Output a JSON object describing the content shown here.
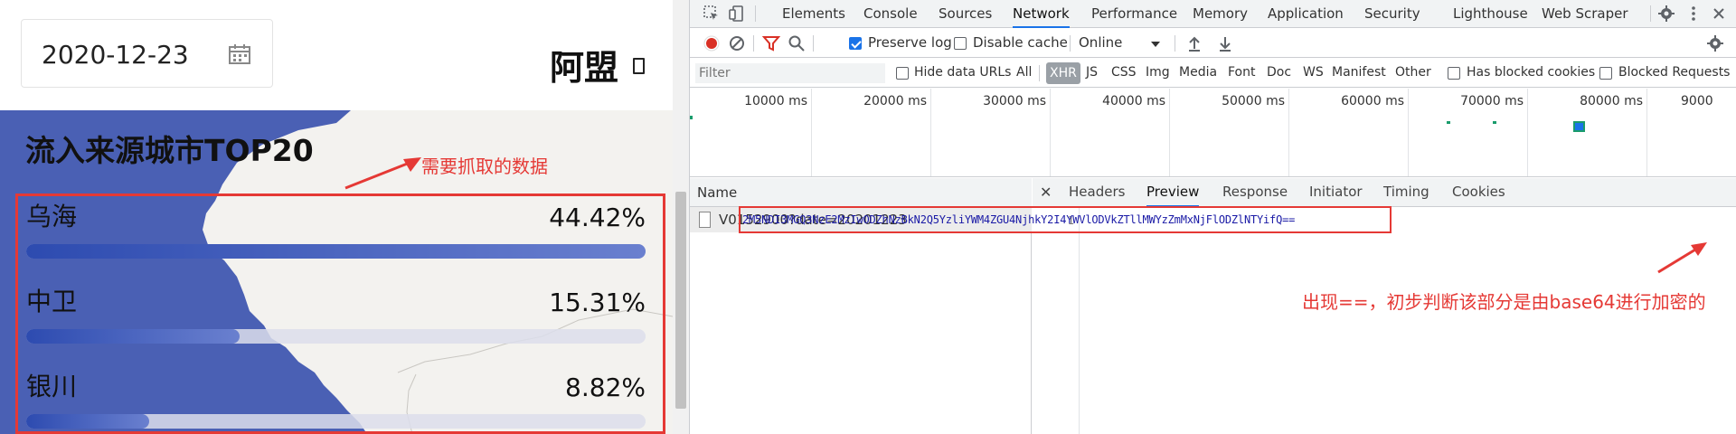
{
  "webpage": {
    "date": "2020-12-23",
    "brand": "阿盟",
    "section_title": "流入来源城市TOP20",
    "annotation": "需要抓取的数据",
    "rows": [
      {
        "city": "乌海",
        "percent": "44.42%",
        "fill": 1.0
      },
      {
        "city": "中卫",
        "percent": "15.31%",
        "fill": 0.345
      },
      {
        "city": "银川",
        "percent": "8.82%",
        "fill": 0.199
      }
    ]
  },
  "devtools": {
    "tabs": [
      "Elements",
      "Console",
      "Sources",
      "Network",
      "Performance",
      "Memory",
      "Application",
      "Security",
      "Lighthouse",
      "Web Scraper"
    ],
    "active_tab": "Network",
    "toolbar": {
      "preserve_log": "Preserve log",
      "disable_cache": "Disable cache",
      "throttle": "Online"
    },
    "filter": {
      "placeholder": "Filter",
      "hide_data_urls": "Hide data URLs",
      "types": [
        "All",
        "XHR",
        "JS",
        "CSS",
        "Img",
        "Media",
        "Font",
        "Doc",
        "WS",
        "Manifest",
        "Other"
      ],
      "active_type": "XHR",
      "has_blocked_cookies": "Has blocked cookies",
      "blocked_requests": "Blocked Requests"
    },
    "timeline_ticks": [
      "10000 ms",
      "20000 ms",
      "30000 ms",
      "40000 ms",
      "50000 ms",
      "60000 ms",
      "70000 ms",
      "80000 ms",
      "9000"
    ],
    "request_list": {
      "column": "Name",
      "rows": [
        "V0152900?date=20201223"
      ]
    },
    "detail_tabs": [
      "Headers",
      "Preview",
      "Response",
      "Initiator",
      "Timing",
      "Cookies"
    ],
    "active_detail_tab": "Preview",
    "preview": {
      "line_number": "1",
      "content": "2M5NDI3MGQ3NzE2MzIwODZhNzBkN2Q5YzliYWM4ZGU4NjhkY2I4YWVlODVkZTllMWYzZmMxNjFlODZlNTYifQ=="
    },
    "annotation": "出现==，初步判断该部分是由base64进行加密的"
  },
  "colors": {
    "accent_blue": "#1a73e8",
    "annotation_red": "#e53935",
    "bar_blue": "#2d4bb0",
    "map_blue": "#4a60b4"
  }
}
